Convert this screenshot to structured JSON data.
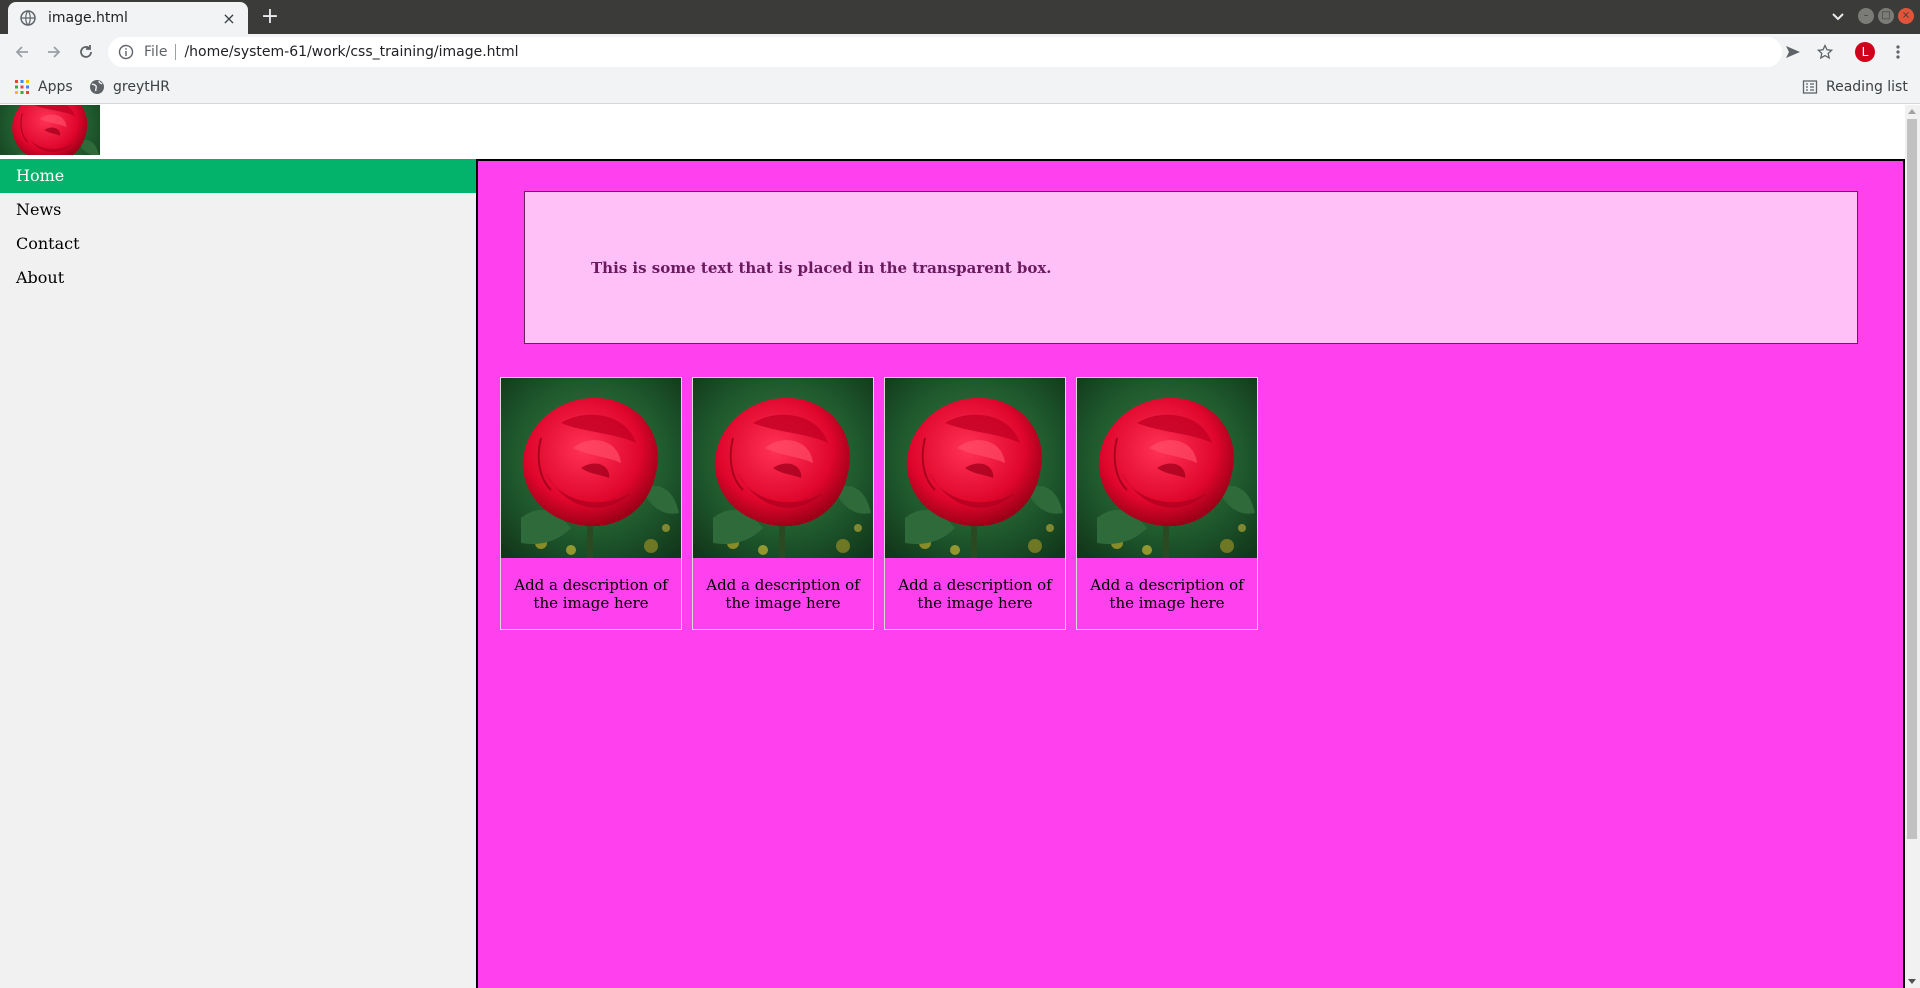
{
  "browser": {
    "tab_title": "image.html",
    "new_tab_symbol": "+",
    "close_symbol": "×",
    "url_scheme_label": "File",
    "url": "/home/system-61/work/css_training/image.html",
    "profile_initial": "L",
    "bookmarks": [
      {
        "label": "Apps",
        "icon": "apps-grid-icon"
      },
      {
        "label": "greytHR",
        "icon": "globe-icon"
      }
    ],
    "reading_list_label": "Reading list"
  },
  "page": {
    "nav": [
      {
        "label": "Home",
        "active": true
      },
      {
        "label": "News",
        "active": false
      },
      {
        "label": "Contact",
        "active": false
      },
      {
        "label": "About",
        "active": false
      }
    ],
    "transparent_box_text": "This is some text that is placed in the transparent box.",
    "gallery": [
      {
        "description": "Add a description of the image here"
      },
      {
        "description": "Add a description of the image here"
      },
      {
        "description": "Add a description of the image here"
      },
      {
        "description": "Add a description of the image here"
      }
    ],
    "colors": {
      "content_bg": "#ff40ee",
      "box_bg": "#ffc0f8",
      "nav_active": "#04b36b",
      "sidenav_bg": "#f1f1f1"
    }
  }
}
